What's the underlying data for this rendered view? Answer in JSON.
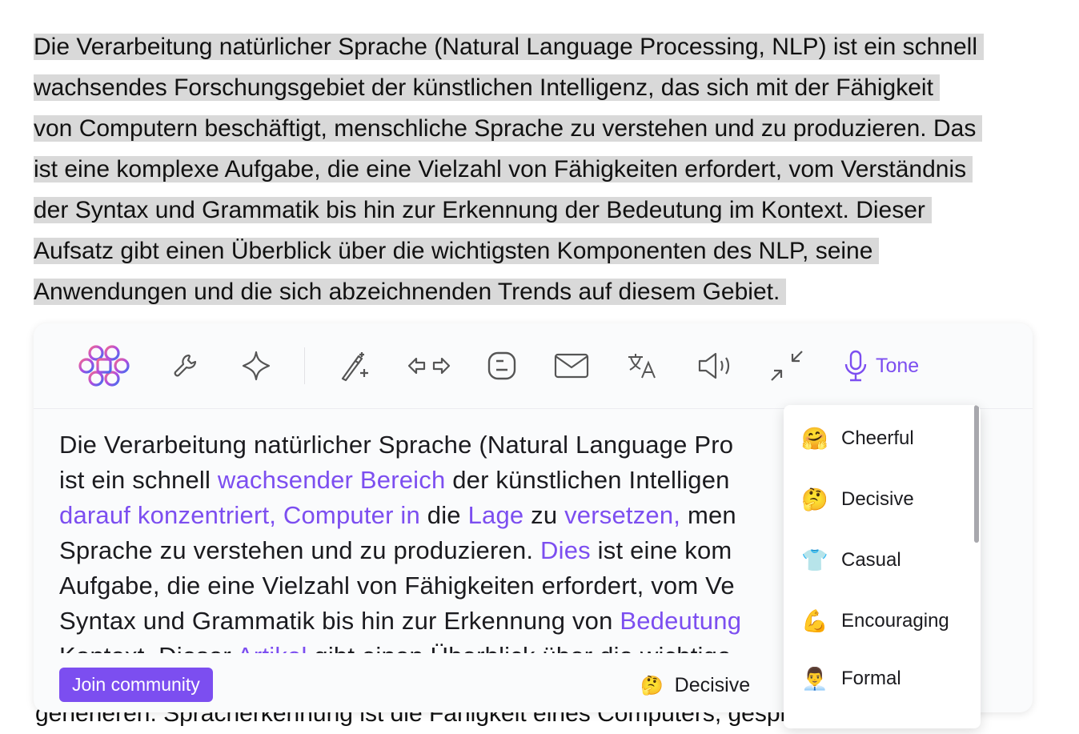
{
  "source_text": {
    "lines": [
      "Die Verarbeitung natürlicher Sprache (Natural Language Processing, NLP) ist ein schnell",
      "wachsendes Forschungsgebiet der künstlichen Intelligenz, das sich mit der Fähigkeit",
      "von Computern beschäftigt, menschliche Sprache zu verstehen und zu produzieren. Das",
      "ist eine komplexe Aufgabe, die eine Vielzahl von Fähigkeiten erfordert, vom Verständnis",
      "der Syntax und Grammatik bis hin zur Erkennung der Bedeutung im Kontext. Dieser",
      "Aufsatz gibt einen Überblick über die wichtigsten Komponenten des NLP, seine",
      "Anwendungen und die sich abzeichnenden Trends auf diesem Gebiet."
    ],
    "below_line": "generieren. Spracherkennung ist die Fähigkeit eines Computers, gesprochene"
  },
  "toolbar": {
    "tone_label": "Tone",
    "icons": [
      "logo-icon",
      "wrench-icon",
      "sparkle-icon",
      "magic-wand-icon",
      "arrows-left-right-icon",
      "blog-icon",
      "mail-icon",
      "translate-icon",
      "speaker-icon",
      "compress-icon",
      "microphone-icon"
    ]
  },
  "rewrite": {
    "lines": [
      [
        {
          "t": "Die Verarbeitung natürlicher Sprache (Natural Language Pro",
          "c": 0
        }
      ],
      [
        {
          "t": "ist ein schnell ",
          "c": 0
        },
        {
          "t": "wachsender Bereich",
          "c": 1
        },
        {
          "t": " der künstlichen Intelligen",
          "c": 0
        }
      ],
      [
        {
          "t": "darauf konzentriert, Computer in",
          "c": 1
        },
        {
          "t": " die ",
          "c": 0
        },
        {
          "t": "Lage",
          "c": 1
        },
        {
          "t": " zu ",
          "c": 0
        },
        {
          "t": "versetzen,",
          "c": 1
        },
        {
          "t": " men",
          "c": 0
        }
      ],
      [
        {
          "t": "Sprache zu verstehen und zu produzieren. ",
          "c": 0
        },
        {
          "t": "Dies",
          "c": 1
        },
        {
          "t": " ist eine kom",
          "c": 0
        }
      ],
      [
        {
          "t": "Aufgabe, die eine Vielzahl von Fähigkeiten erfordert, vom Ve",
          "c": 0
        }
      ],
      [
        {
          "t": "Syntax und Grammatik bis hin zur Erkennung von ",
          "c": 0
        },
        {
          "t": "Bedeutung",
          "c": 1
        }
      ],
      [
        {
          "t": "Kontext. Dieser ",
          "c": 0
        },
        {
          "t": "Artikel",
          "c": 1
        },
        {
          "t": " gibt einen Überblick über die wichtige",
          "c": 0
        }
      ]
    ]
  },
  "footer": {
    "join_button": "Join community",
    "selected_tone": {
      "emoji": "🤔",
      "label": "Decisive"
    }
  },
  "tone_menu": {
    "options": [
      {
        "emoji": "🤗",
        "label": "Cheerful"
      },
      {
        "emoji": "🤔",
        "label": "Decisive"
      },
      {
        "emoji": "👕",
        "label": "Casual"
      },
      {
        "emoji": "💪",
        "label": "Encouraging"
      },
      {
        "emoji": "👨‍💼",
        "label": "Formal"
      }
    ]
  },
  "colors": {
    "accent": "#7c4ef0",
    "highlight": "#d9d9d9"
  }
}
